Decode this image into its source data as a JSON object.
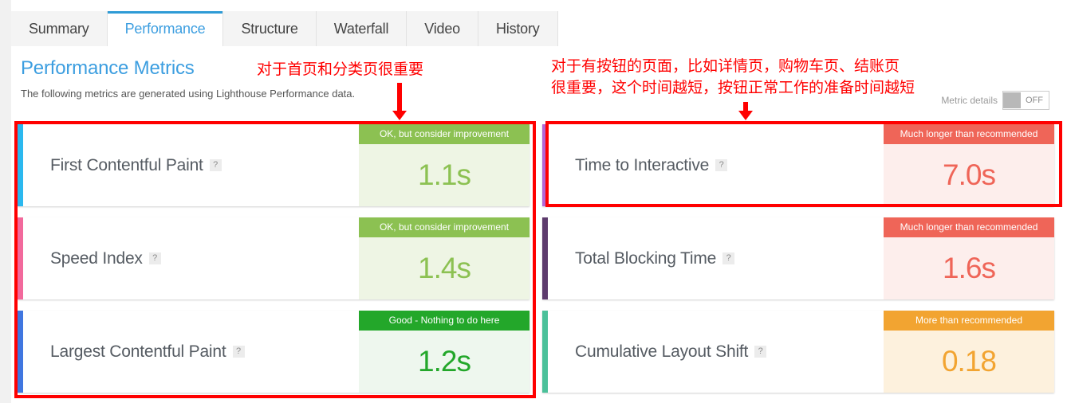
{
  "tabs": [
    {
      "label": "Summary",
      "active": false
    },
    {
      "label": "Performance",
      "active": true
    },
    {
      "label": "Structure",
      "active": false
    },
    {
      "label": "Waterfall",
      "active": false
    },
    {
      "label": "Video",
      "active": false
    },
    {
      "label": "History",
      "active": false
    }
  ],
  "header": {
    "title": "Performance Metrics",
    "subtitle": "The following metrics are generated using Lighthouse Performance data."
  },
  "metric_details": {
    "label": "Metric details",
    "state": "OFF"
  },
  "help_glyph": "?",
  "metrics": {
    "left": [
      {
        "name": "First Contentful Paint",
        "status": "OK, but consider improvement",
        "value": "1.1s",
        "accent": "#2bb8ef",
        "status_bg": "#8cc152",
        "value_bg": "#eef5e4",
        "value_color": "#8cc152"
      },
      {
        "name": "Speed Index",
        "status": "OK, but consider improvement",
        "value": "1.4s",
        "accent": "#f2699c",
        "status_bg": "#8cc152",
        "value_bg": "#eef5e4",
        "value_color": "#8cc152"
      },
      {
        "name": "Largest Contentful Paint",
        "status": "Good - Nothing to do here",
        "value": "1.2s",
        "accent": "#4076e0",
        "status_bg": "#23a72a",
        "value_bg": "#eef7ee",
        "value_color": "#23a72a"
      }
    ],
    "right": [
      {
        "name": "Time to Interactive",
        "status": "Much longer than recommended",
        "value": "7.0s",
        "accent": "#b367d6",
        "status_bg": "#ef6558",
        "value_bg": "#fdeeec",
        "value_color": "#ef6558"
      },
      {
        "name": "Total Blocking Time",
        "status": "Much longer than recommended",
        "value": "1.6s",
        "accent": "#5d3b6d",
        "status_bg": "#ef6558",
        "value_bg": "#fdeeec",
        "value_color": "#ef6558"
      },
      {
        "name": "Cumulative Layout Shift",
        "status": "More than recommended",
        "value": "0.18",
        "accent": "#4bc19a",
        "status_bg": "#f2a431",
        "value_bg": "#fdf1dd",
        "value_color": "#f2a431"
      }
    ]
  },
  "annotations": {
    "color": "#ff0000",
    "note_left": "对于首页和分类页很重要",
    "note_right_line1": "对于有按钮的页面，比如详情页，购物车页、结账页",
    "note_right_line2": "很重要，这个时间越短，按钮正常工作的准备时间越短"
  }
}
